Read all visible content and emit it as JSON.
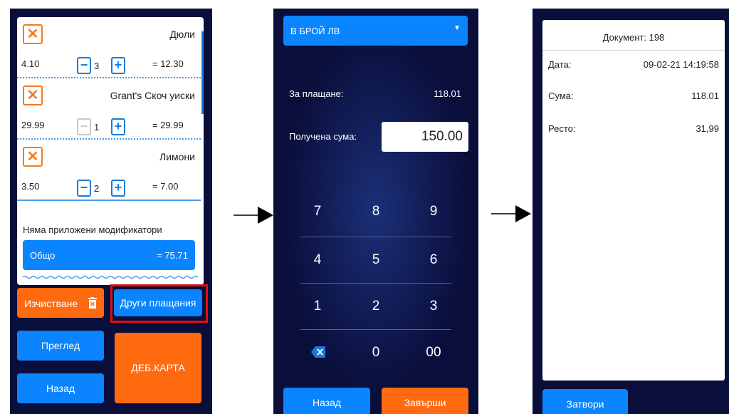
{
  "cart": {
    "items": [
      {
        "name": "Дюли",
        "price": "4.10",
        "qty": "3",
        "sum": "= 12.30",
        "minus_disabled": false
      },
      {
        "name": "Grant's Скоч уиски",
        "price": "29.99",
        "qty": "1",
        "sum": "= 29.99",
        "minus_disabled": true
      },
      {
        "name": "Лимони",
        "price": "3.50",
        "qty": "2",
        "sum": "= 7.00",
        "minus_disabled": false
      }
    ],
    "modifiers_text": "Няма приложени модификатори",
    "total_label": "Общо",
    "total_value": "= 75.71"
  },
  "panel1_buttons": {
    "clear": "Изчистване",
    "other_payments": "Други плащания",
    "review": "Преглед",
    "debit_card": "ДЕБ.КАРТА",
    "back": "Назад"
  },
  "payment": {
    "method": "В БРОЙ ЛВ",
    "to_pay_label": "За плащане:",
    "to_pay_value": "118.01",
    "received_label": "Получена сума:",
    "received_value": "150.00",
    "keys": [
      "7",
      "8",
      "9",
      "4",
      "5",
      "6",
      "1",
      "2",
      "3",
      "⌫",
      "0",
      "00"
    ],
    "back": "Назад",
    "finish": "Завърши"
  },
  "receipt": {
    "document": "Документ: 198",
    "date_label": "Дата:",
    "date_value": "09-02-21 14:19:58",
    "sum_label": "Сума:",
    "sum_value": "118.01",
    "change_label": "Ресто:",
    "change_value": "31,99",
    "close": "Затвори"
  },
  "colors": {
    "navy": "#0a0e3a",
    "blue": "#0a84ff",
    "orange": "#ff6a10",
    "highlight": "#e01010"
  }
}
